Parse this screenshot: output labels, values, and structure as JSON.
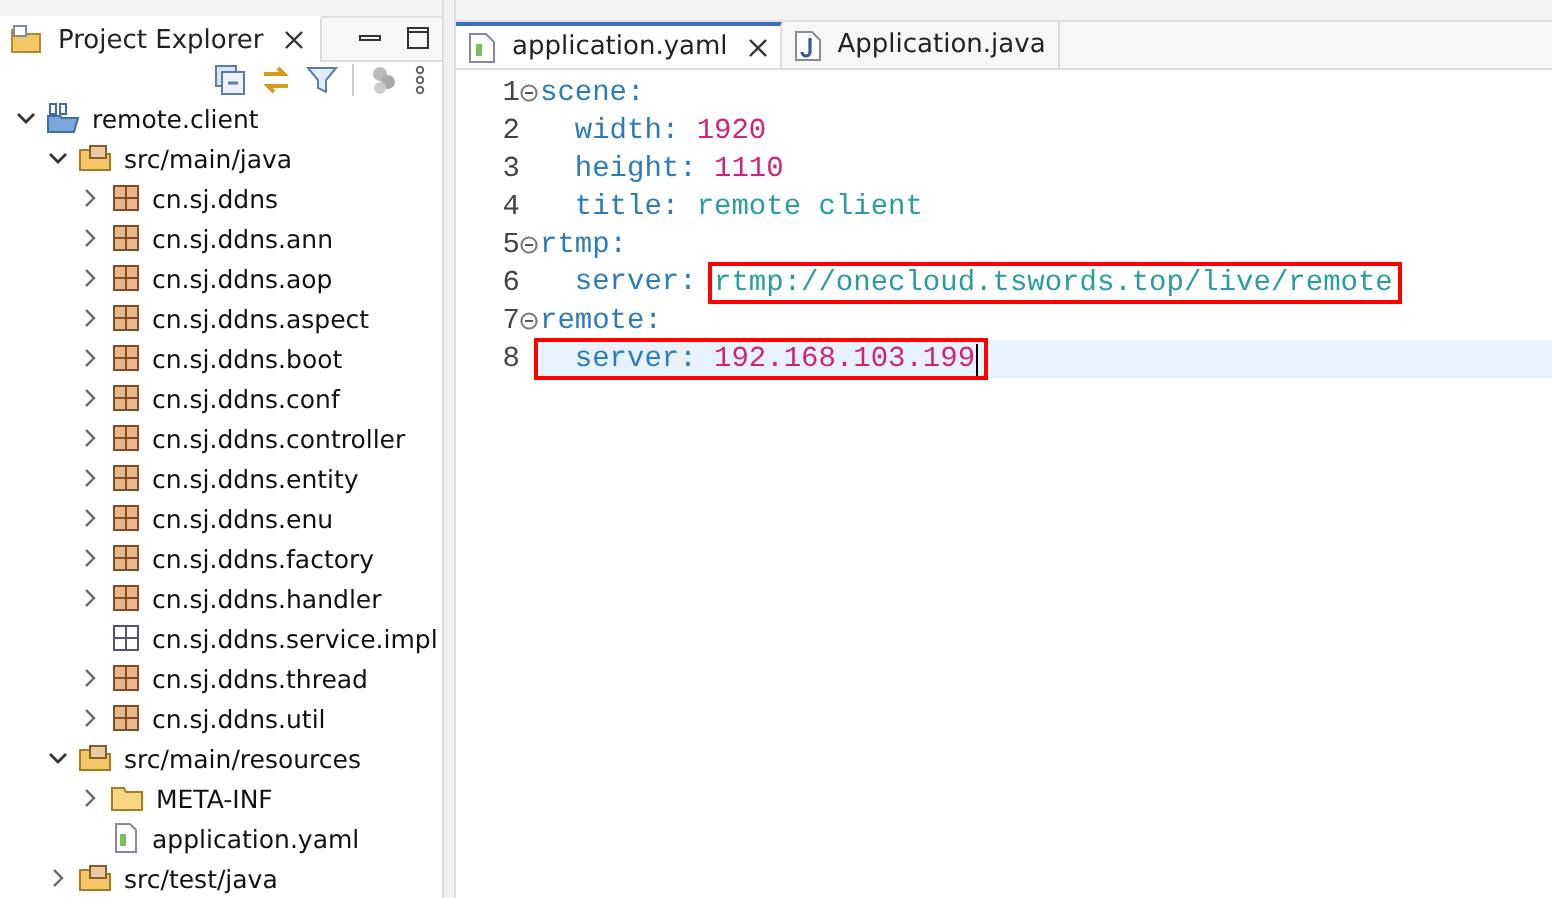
{
  "explorer": {
    "title": "Project Explorer",
    "tree": [
      {
        "label": "remote.client",
        "kind": "project",
        "expanded": true,
        "children": [
          {
            "label": "src/main/java",
            "kind": "source",
            "expanded": true,
            "children": [
              {
                "label": "cn.sj.ddns",
                "kind": "package",
                "expanded": false
              },
              {
                "label": "cn.sj.ddns.ann",
                "kind": "package",
                "expanded": false
              },
              {
                "label": "cn.sj.ddns.aop",
                "kind": "package",
                "expanded": false
              },
              {
                "label": "cn.sj.ddns.aspect",
                "kind": "package",
                "expanded": false
              },
              {
                "label": "cn.sj.ddns.boot",
                "kind": "package",
                "expanded": false
              },
              {
                "label": "cn.sj.ddns.conf",
                "kind": "package",
                "expanded": false
              },
              {
                "label": "cn.sj.ddns.controller",
                "kind": "package",
                "expanded": false
              },
              {
                "label": "cn.sj.ddns.entity",
                "kind": "package",
                "expanded": false
              },
              {
                "label": "cn.sj.ddns.enu",
                "kind": "package",
                "expanded": false
              },
              {
                "label": "cn.sj.ddns.factory",
                "kind": "package",
                "expanded": false
              },
              {
                "label": "cn.sj.ddns.handler",
                "kind": "package",
                "expanded": false
              },
              {
                "label": "cn.sj.ddns.service.impl",
                "kind": "empty-package"
              },
              {
                "label": "cn.sj.ddns.thread",
                "kind": "package",
                "expanded": false
              },
              {
                "label": "cn.sj.ddns.util",
                "kind": "package",
                "expanded": false
              }
            ]
          },
          {
            "label": "src/main/resources",
            "kind": "source",
            "expanded": true,
            "children": [
              {
                "label": "META-INF",
                "kind": "folder",
                "expanded": false
              },
              {
                "label": "application.yaml",
                "kind": "file"
              }
            ]
          },
          {
            "label": "src/test/java",
            "kind": "source",
            "expanded": false
          }
        ]
      }
    ]
  },
  "editor": {
    "tabs": [
      {
        "label": "application.yaml",
        "kind": "yaml",
        "selected": true
      },
      {
        "label": "Application.java",
        "kind": "java",
        "selected": false
      }
    ],
    "lines": [
      {
        "number": "1",
        "foldable": true,
        "key": "scene:"
      },
      {
        "number": "2",
        "key": "  width:",
        "value": " 1920",
        "kind": "number"
      },
      {
        "number": "3",
        "key": "  height:",
        "value": " 1110",
        "kind": "number"
      },
      {
        "number": "4",
        "key": "  title:",
        "value": " remote client",
        "kind": "string"
      },
      {
        "number": "5",
        "foldable": true,
        "key": "rtmp:"
      },
      {
        "number": "6",
        "key": "  server: ",
        "value": "rtmp://onecloud.tswords.top/live/remote",
        "kind": "string",
        "value_boxed": true
      },
      {
        "number": "7",
        "foldable": true,
        "key": "remote:"
      },
      {
        "number": "8",
        "key": "  server: ",
        "value": "192.168.103.199",
        "kind": "number",
        "line_boxed": true,
        "current": true
      }
    ]
  }
}
